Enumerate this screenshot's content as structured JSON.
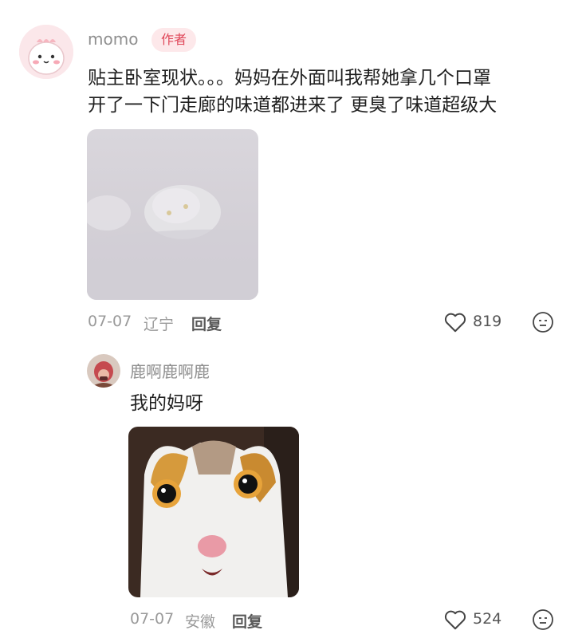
{
  "comment": {
    "username": "momo",
    "author_badge": "作者",
    "text_line1": "贴主卧室现状。。。妈妈在外面叫我帮她拿几个口罩",
    "text_line2": "开了一下门走廊的味道都进来了 更臭了味道超级大",
    "date": "07-07",
    "location": "辽宁",
    "reply_label": "回复",
    "like_count": "819",
    "icons": {
      "like": "heart-outline-icon",
      "emoji": "emoji-icon"
    }
  },
  "reply": {
    "username": "鹿啊鹿啊鹿",
    "text": "我的妈呀",
    "date": "07-07",
    "location": "安徽",
    "reply_label": "回复",
    "like_count": "524",
    "icons": {
      "like": "heart-outline-icon",
      "emoji": "emoji-icon"
    }
  }
}
